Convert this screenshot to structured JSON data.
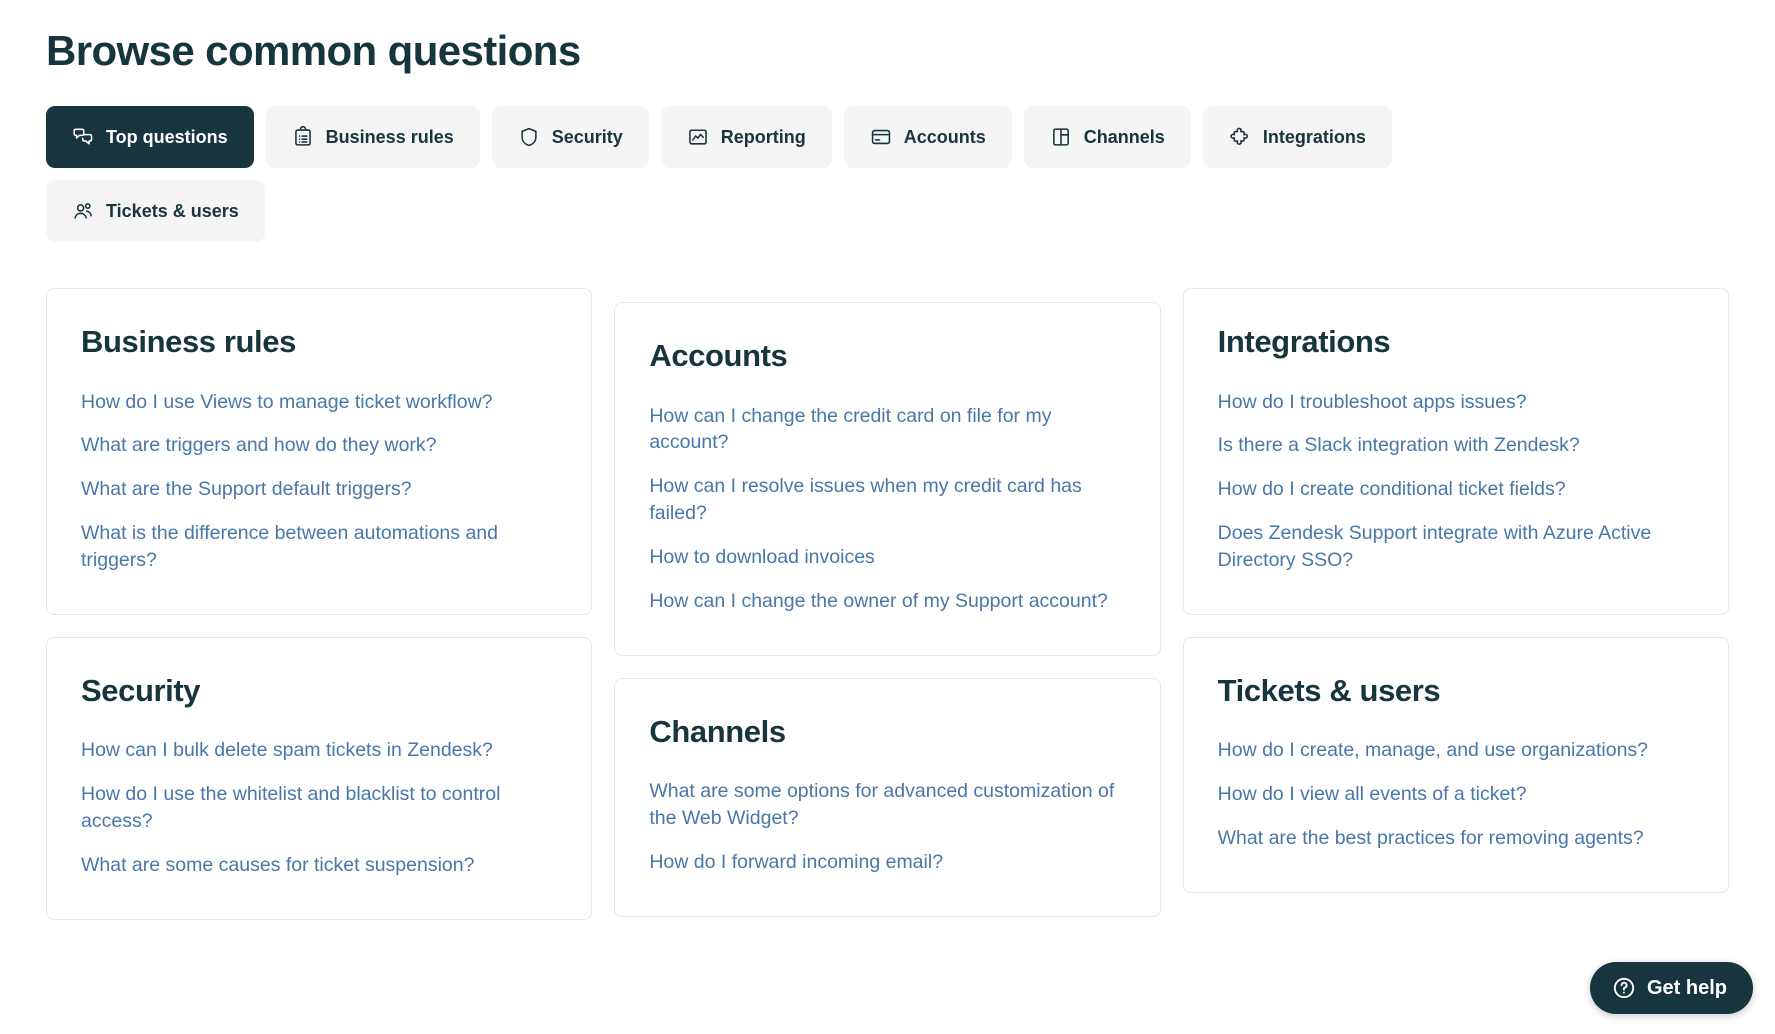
{
  "page": {
    "title": "Browse common questions"
  },
  "tabs": [
    {
      "label": "Top questions",
      "icon": "chat-bubbles-icon",
      "active": true
    },
    {
      "label": "Business rules",
      "icon": "clipboard-list-icon",
      "active": false
    },
    {
      "label": "Security",
      "icon": "shield-icon",
      "active": false
    },
    {
      "label": "Reporting",
      "icon": "chart-line-icon",
      "active": false
    },
    {
      "label": "Accounts",
      "icon": "credit-card-icon",
      "active": false
    },
    {
      "label": "Channels",
      "icon": "layout-panel-icon",
      "active": false
    },
    {
      "label": "Integrations",
      "icon": "puzzle-piece-icon",
      "active": false
    },
    {
      "label": "Tickets & users",
      "icon": "users-icon",
      "active": false
    }
  ],
  "columns": [
    {
      "cards": [
        {
          "title": "Business rules",
          "links": [
            "How do I use Views to manage ticket workflow?",
            "What are triggers and how do they work?",
            "What are the Support default triggers?",
            "What is the difference between automations and triggers?"
          ]
        },
        {
          "title": "Security",
          "links": [
            "How can I bulk delete spam tickets in Zendesk?",
            "How do I use the whitelist and blacklist to control access?",
            "What are some causes for ticket suspension?"
          ]
        }
      ]
    },
    {
      "cards": [
        {
          "title": "Accounts",
          "links": [
            "How can I change the credit card on file for my account?",
            "How can I resolve issues when my credit card has failed?",
            "How to download invoices",
            "How can I change the owner of my Support account?"
          ]
        },
        {
          "title": "Channels",
          "links": [
            "What are some options for advanced customization of the Web Widget?",
            "How do I forward incoming email?"
          ]
        }
      ]
    },
    {
      "cards": [
        {
          "title": "Integrations",
          "links": [
            "How do I troubleshoot apps issues?",
            "Is there a Slack integration with Zendesk?",
            "How do I create conditional ticket fields?",
            "Does Zendesk Support integrate with Azure Active Directory SSO?"
          ]
        },
        {
          "title": "Tickets & users",
          "links": [
            "How do I create, manage, and use organizations?",
            "How do I view all events of a ticket?",
            "What are the best practices for removing agents?"
          ]
        }
      ]
    }
  ],
  "widget": {
    "label": "Get help",
    "icon": "question-circle-icon"
  },
  "colors": {
    "brand_dark": "#17353d",
    "tab_inactive_bg": "#f5f5f5",
    "link_blue": "#4877a8",
    "card_border": "#e4e7e8",
    "page_bg": "#ffffff"
  }
}
